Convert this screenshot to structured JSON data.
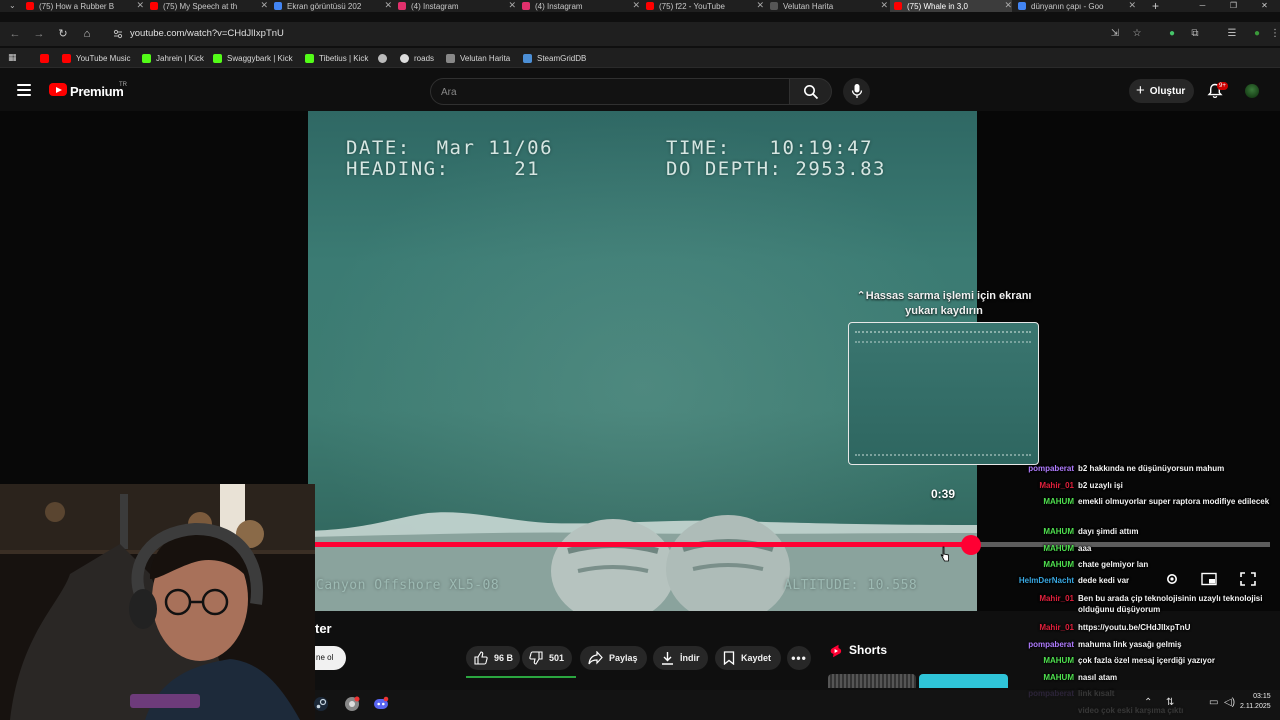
{
  "browser": {
    "tabs": [
      {
        "title": "(75) How a Rubber B",
        "icon": "youtube-icon",
        "color": "#ff0000"
      },
      {
        "title": "(75) My Speech at th",
        "icon": "youtube-icon",
        "color": "#ff0000"
      },
      {
        "title": "Ekran görüntüsü 202",
        "icon": "google-icon",
        "color": "#4285f4"
      },
      {
        "title": "(4) Instagram",
        "icon": "instagram-icon",
        "color": "#e1306c"
      },
      {
        "title": "(4) Instagram",
        "icon": "instagram-icon",
        "color": "#e1306c"
      },
      {
        "title": "(75) f22 - YouTube",
        "icon": "youtube-icon",
        "color": "#ff0000"
      },
      {
        "title": "Velutan Harita",
        "icon": "velutan-icon",
        "color": "#555555"
      },
      {
        "title": "(75) Whale in 3,0",
        "icon": "youtube-icon",
        "color": "#ff0000",
        "active": true
      },
      {
        "title": "dünyanın çapı - Goo",
        "icon": "google-icon",
        "color": "#4285f4"
      }
    ],
    "url": "youtube.com/watch?v=CHdJlIxpTnU",
    "bookmarks": [
      {
        "label": "",
        "icon": "youtube-icon",
        "color": "#ff0000"
      },
      {
        "label": "YouTube Music",
        "icon": "youtube-music-icon",
        "color": "#ff0000"
      },
      {
        "label": "Jahrein | Kick",
        "icon": "kick-icon",
        "color": "#53fc18"
      },
      {
        "label": "Swaggybark | Kick",
        "icon": "kick-icon",
        "color": "#53fc18"
      },
      {
        "label": "Tibetius | Kick",
        "icon": "kick-icon",
        "color": "#53fc18"
      },
      {
        "label": "",
        "icon": "globe-icon",
        "color": "#bbbbbb"
      },
      {
        "label": "roads",
        "icon": "roads-icon",
        "color": "#dddddd"
      },
      {
        "label": "Velutan Harita",
        "icon": "velutan-icon",
        "color": "#888888"
      },
      {
        "label": "SteamGridDB",
        "icon": "steamgriddb-icon",
        "color": "#4c8fd6"
      }
    ]
  },
  "youtube": {
    "brand": "Premium",
    "region": "TR",
    "search_placeholder": "Ara",
    "create_label": "Oluştur",
    "notifications_badge": "9+"
  },
  "player": {
    "osd_line1_left": "DATE:  Mar 11/06",
    "osd_line1_right": "TIME:   10:19:47",
    "osd_line2_left": "HEADING:     21",
    "osd_line2_right": "DO DEPTH: 2953.83",
    "osd_bottom_left": "Canyon Offshore XL5-08",
    "osd_bottom_right": "ALTITUDE: 10.558",
    "scrub_hint": "Hassas sarma işlemi için ekranı yukarı kaydırın",
    "preview_time": "0:39",
    "progress_fraction": 0.687,
    "accent_color": "#ff0033"
  },
  "below_video": {
    "title_fragment": "ter",
    "subscribe_fragment": "ne ol",
    "like_count": "96 B",
    "dislike_count": "501",
    "share_label": "Paylaş",
    "download_label": "İndir",
    "save_label": "Kaydet",
    "shorts_label": "Shorts"
  },
  "chat": [
    {
      "user": "pompaberat",
      "text": "b2 hakkında ne düşünüyorsun mahum",
      "color": "#b07cff"
    },
    {
      "user": "Mahir_01",
      "text": "b2 uzaylı işi",
      "color": "#e0203c"
    },
    {
      "user": "MAHUM",
      "text": "emekli olmuyorlar super raptora modifiye edilecek",
      "color": "#4fe04f"
    },
    {
      "user": "MAHUM",
      "text": "dayı şimdi attım",
      "color": "#4fe04f"
    },
    {
      "user": "MAHUM",
      "text": "aaa",
      "color": "#4fe04f"
    },
    {
      "user": "MAHUM",
      "text": "chate gelmiyor lan",
      "color": "#4fe04f"
    },
    {
      "user": "HelmDerNacht",
      "text": "dede kedi var",
      "color": "#39a7e0"
    },
    {
      "user": "Mahir_01",
      "text": "Ben bu arada çip teknolojisinin uzaylı teknolojisi olduğunu düşüyorum",
      "color": "#e0203c"
    },
    {
      "user": "Mahir_01",
      "text": "https://youtu.be/CHdJlIxpTnU",
      "color": "#e0203c"
    },
    {
      "user": "pompaberat",
      "text": "mahuma link yasağı gelmiş",
      "color": "#b07cff"
    },
    {
      "user": "MAHUM",
      "text": "çok fazla özel mesaj içerdiği yazıyor",
      "color": "#4fe04f"
    },
    {
      "user": "MAHUM",
      "text": "nasıl atam",
      "color": "#4fe04f"
    },
    {
      "user": "pompaberat",
      "text": "link kısalt",
      "color": "#b07cff"
    },
    {
      "user": "",
      "text": "video çok eski karşıma çıktı",
      "color": "#cccccc"
    }
  ],
  "taskbar": {
    "time": "03:15",
    "date": "2.11.2025"
  }
}
